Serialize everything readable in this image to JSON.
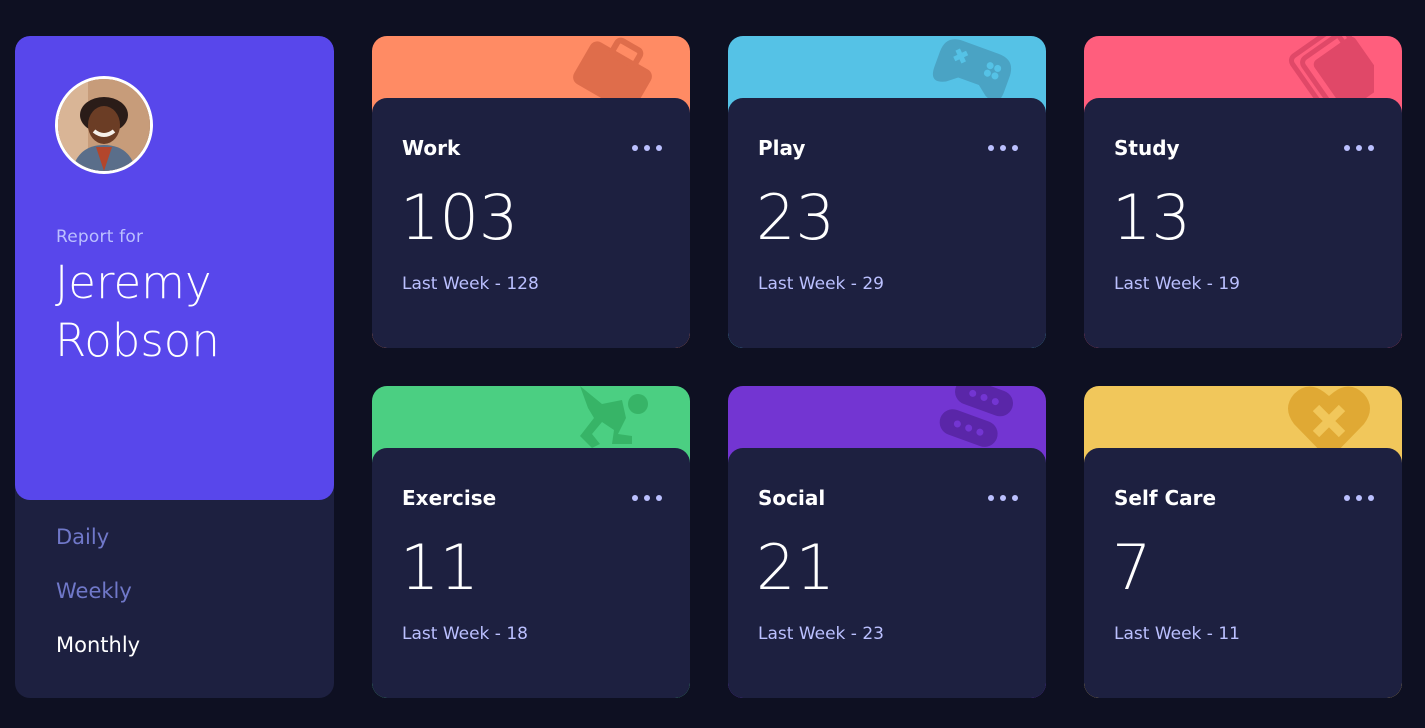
{
  "profile": {
    "report_label": "Report for",
    "name_first": "Jeremy",
    "name_last": "Robson",
    "avatar_icon": "user-avatar-photo"
  },
  "periods": [
    {
      "label": "Daily",
      "active": false
    },
    {
      "label": "Weekly",
      "active": false
    },
    {
      "label": "Monthly",
      "active": true
    }
  ],
  "cards": [
    {
      "title": "Work",
      "hours": "103",
      "previous": "Last Week - 128",
      "color": "#ff8b64",
      "icon": "briefcase-icon",
      "icon_color": "#df6d4b"
    },
    {
      "title": "Play",
      "hours": "23",
      "previous": "Last Week - 29",
      "color": "#55c2e6",
      "icon": "game-controller-icon",
      "icon_color": "#4aa3c4"
    },
    {
      "title": "Study",
      "hours": "13",
      "previous": "Last Week - 19",
      "color": "#ff5e7d",
      "icon": "books-icon",
      "icon_color": "#e04868"
    },
    {
      "title": "Exercise",
      "hours": "11",
      "previous": "Last Week - 18",
      "color": "#4bcf82",
      "icon": "runner-icon",
      "icon_color": "#37b467"
    },
    {
      "title": "Social",
      "hours": "21",
      "previous": "Last Week - 23",
      "color": "#7335d2",
      "icon": "chat-bubbles-icon",
      "icon_color": "#5a26a8"
    },
    {
      "title": "Self Care",
      "hours": "7",
      "previous": "Last Week - 11",
      "color": "#f1c75b",
      "icon": "heart-bandage-icon",
      "icon_color": "#e0a934"
    }
  ]
}
